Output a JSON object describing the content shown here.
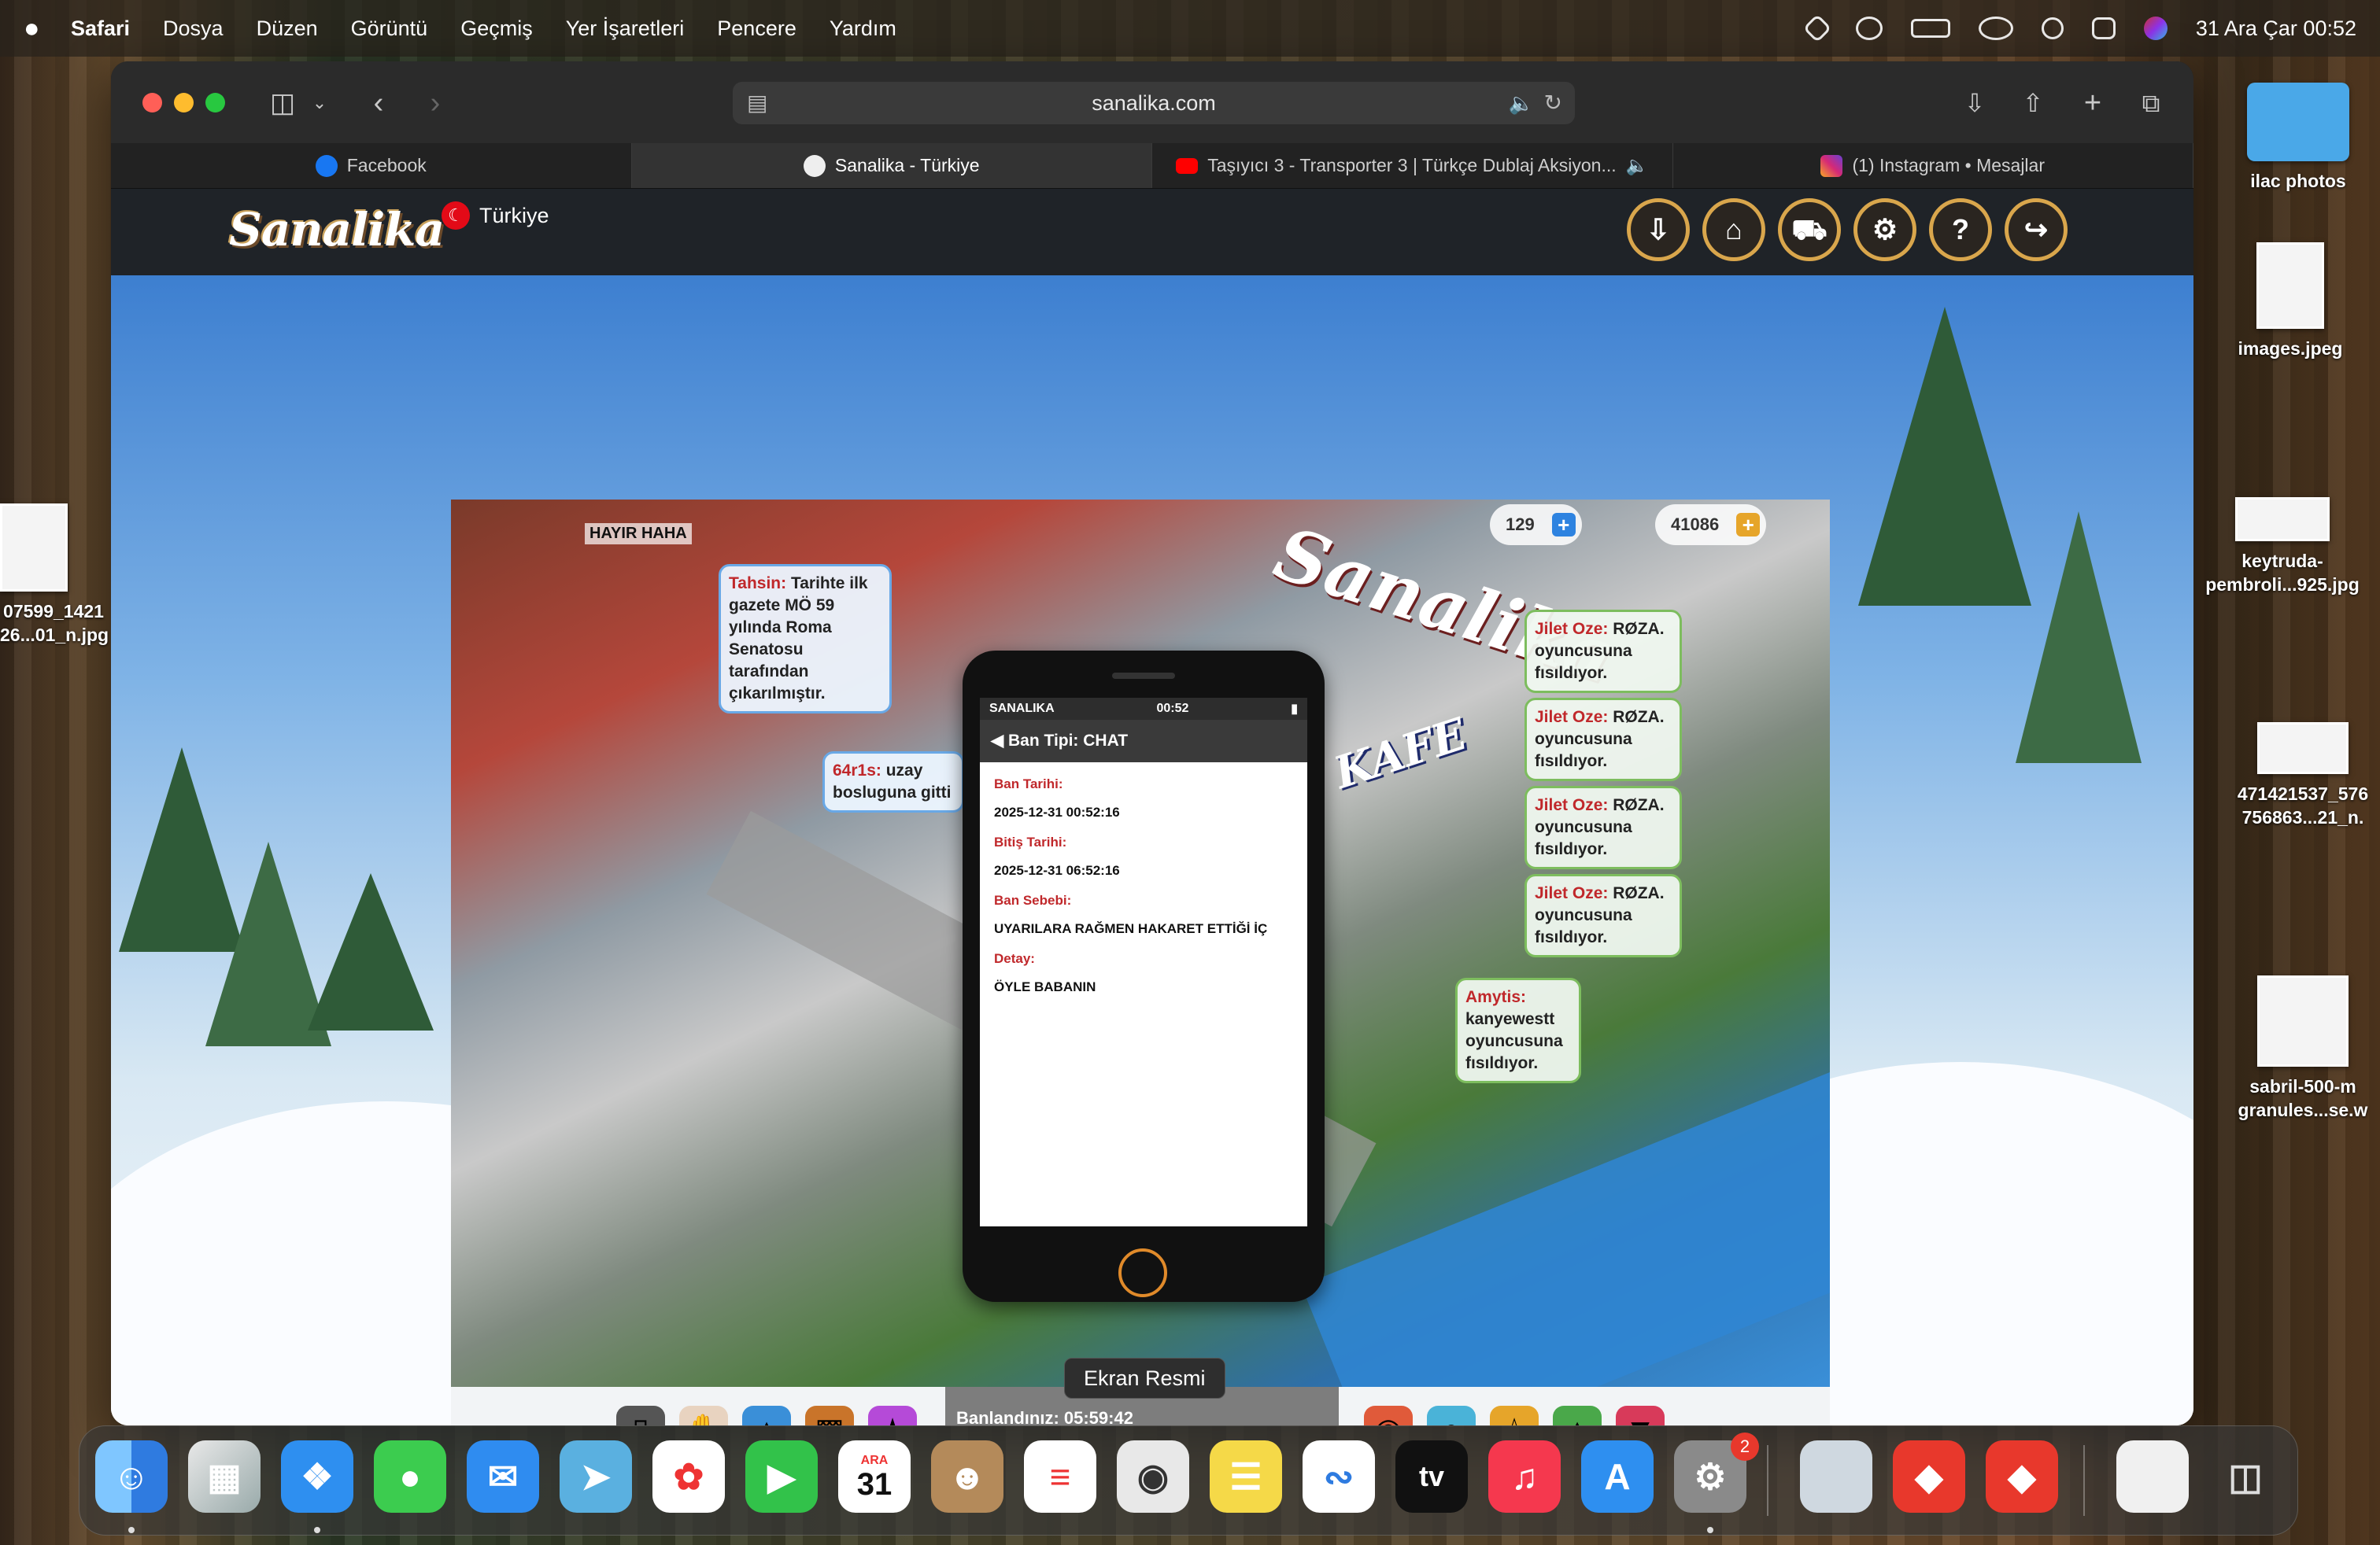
{
  "menubar": {
    "apple": "",
    "app": "Safari",
    "items": [
      "Dosya",
      "Düzen",
      "Görüntü",
      "Geçmiş",
      "Yer İşaretleri",
      "Pencere",
      "Yardım"
    ],
    "clock": "31 Ara Çar  00:52"
  },
  "browser": {
    "url": "sanalika.com",
    "tabs": [
      {
        "label": "Facebook",
        "color": "#1877f2"
      },
      {
        "label": "Sanalika - Türkiye",
        "color": "#f0f0f0"
      },
      {
        "label": "Taşıyıcı 3 - Transporter 3 | Türkçe Dublaj Aksiyon...",
        "color": "#ff0000"
      },
      {
        "label": "(1) Instagram • Mesajlar",
        "color": "#d62976"
      }
    ]
  },
  "site": {
    "logo": "Sanalika",
    "country": "Türkiye",
    "nav_icons": [
      "download-icon",
      "home-icon",
      "cart-icon",
      "gear-icon",
      "help-icon",
      "logout-icon"
    ]
  },
  "game": {
    "diamonds": "129",
    "gold": "41086",
    "top_left_label": "HAYIR HAHA",
    "sign": "Sanalika",
    "kafe": "KAFE",
    "bubbles": [
      {
        "name": "Tahsin:",
        "text": "Tarihte ilk gazete  MÖ 59 yılında Roma Senatosu tarafından çıkarılmıştır."
      },
      {
        "name": "64r1s:",
        "text": "uzay bosluguna gitti"
      },
      {
        "name": "Jilet Oze:",
        "text": "RØZA. oyuncusuna fısıldıyor."
      },
      {
        "name": "Jilet Oze:",
        "text": "RØZA. oyuncusuna fısıldıyor."
      },
      {
        "name": "Jilet Oze:",
        "text": "RØZA. oyuncusuna fısıldıyor."
      },
      {
        "name": "Jilet Oze:",
        "text": "RØZA. oyuncusuna fısıldıyor."
      },
      {
        "name": "Amytis:",
        "text": "kanyewestt oyuncusuna fısıldıyor."
      }
    ],
    "phone": {
      "carrier": "SANALIKA",
      "time": "00:52",
      "title": "Ban Tipi: CHAT",
      "fields": [
        {
          "label": "Ban Tarihi:",
          "value": "2025-12-31 00:52:16"
        },
        {
          "label": "Bitiş Tarihi:",
          "value": "2025-12-31 06:52:16"
        },
        {
          "label": "Ban Sebebi:",
          "value": "UYARILARA RAĞMEN HAKARET ETTİĞİ İÇ"
        },
        {
          "label": "Detay:",
          "value": "ÖYLE BABANIN"
        }
      ]
    },
    "ban_bar": "Banlandınız: 05:59:42"
  },
  "tooltip": "Ekran Resmi",
  "dock": {
    "calendar_month": "ARA",
    "calendar_day": "31",
    "badge": "2",
    "tv_label": "tv"
  },
  "desktop": [
    {
      "label": "ilac photos"
    },
    {
      "label": "images.jpeg"
    },
    {
      "label": "keytruda-pembroli...925.jpg"
    },
    {
      "label": "471421537_576 756863...21_n."
    },
    {
      "label": "sabril-500-m granules...se.w"
    },
    {
      "label": "07599_1421 26...01_n.jpg"
    }
  ]
}
